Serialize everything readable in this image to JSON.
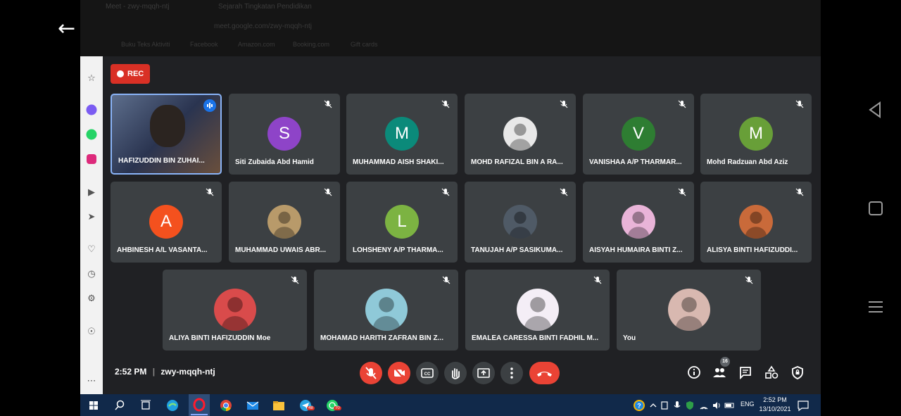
{
  "browser": {
    "tab_active": "Meet - zwy-mqqh-ntj",
    "tab_second": "Sejarah Tingkatan Pendidikan",
    "url": "meet.google.com/zwy-mqqh-ntj",
    "bookmarks": [
      "Buku Teks Aktiviti",
      "Facebook",
      "Amazon.com",
      "Booking.com",
      "Gift cards"
    ]
  },
  "meet": {
    "rec_label": "REC",
    "time": "2:52 PM",
    "separator": "|",
    "meeting_code": "zwy-mqqh-ntj",
    "people_count": "16"
  },
  "participants": [
    {
      "name": "HAFIZUDDIN BIN ZUHAI...",
      "kind": "video"
    },
    {
      "name": "Siti Zubaida Abd Hamid",
      "kind": "letter",
      "letter": "S",
      "color": "#8e44c8"
    },
    {
      "name": "MUHAMMAD AISH SHAKI...",
      "kind": "letter",
      "letter": "M",
      "color": "#0b8a7a"
    },
    {
      "name": "MOHD RAFIZAL BIN A RA...",
      "kind": "photo",
      "color": "#e8e8e8"
    },
    {
      "name": "VANISHAA A/P THARMAR...",
      "kind": "letter",
      "letter": "V",
      "color": "#2e7d32"
    },
    {
      "name": "Mohd Radzuan Abd Aziz",
      "kind": "letter",
      "letter": "M",
      "color": "#689f38"
    },
    {
      "name": "AHBINESH A/L VASANTA...",
      "kind": "letter",
      "letter": "A",
      "color": "#f4511e"
    },
    {
      "name": "MUHAMMAD UWAIS ABR...",
      "kind": "photo",
      "color": "#b89a6a"
    },
    {
      "name": "LOHSHENY A/P THARMA...",
      "kind": "letter",
      "letter": "L",
      "color": "#7cb342"
    },
    {
      "name": "TANUJAH A/P SASIKUMA...",
      "kind": "photo",
      "color": "#4f5a66"
    },
    {
      "name": "AISYAH HUMAIRA BINTI Z...",
      "kind": "photo",
      "color": "#e9b4d8"
    },
    {
      "name": "ALISYA BINTI HAFIZUDDI...",
      "kind": "photo",
      "color": "#c96a3a"
    },
    {
      "name": "ALIYA BINTI HAFIZUDDIN Moe",
      "kind": "photo",
      "color": "#d94b4b"
    },
    {
      "name": "MOHAMAD HARITH ZAFRAN BIN Z...",
      "kind": "photo",
      "color": "#8fc9d8"
    },
    {
      "name": "EMALEA CARESSA BINTI FADHIL M...",
      "kind": "photo",
      "color": "#f4eef6"
    },
    {
      "name": "You",
      "kind": "photo",
      "color": "#d8b8b0"
    }
  ],
  "taskbar": {
    "time": "2:52 PM",
    "date": "13/10/2021",
    "lang": "ENG",
    "badge_telegram": "48",
    "badge_whatsapp": "70"
  },
  "colors": {
    "rec_red": "#d93025",
    "tile": "#3c4043",
    "meet_bg": "#202124",
    "hangup": "#ea4335",
    "speaking_border": "#8ab4f8"
  }
}
